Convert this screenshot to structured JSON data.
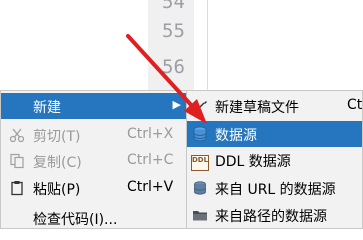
{
  "editor": {
    "line_numbers": [
      "54",
      "55",
      "56"
    ]
  },
  "context_menu": {
    "items": [
      {
        "label": "新建",
        "shortcut": "",
        "has_submenu": true,
        "icon": "",
        "state": "highlighted"
      },
      {
        "label": "剪切(T)",
        "shortcut": "Ctrl+X",
        "has_submenu": false,
        "icon": "scissors-icon",
        "state": "disabled"
      },
      {
        "label": "复制(C)",
        "shortcut": "Ctrl+C",
        "has_submenu": false,
        "icon": "copy-icon",
        "state": "disabled"
      },
      {
        "label": "粘贴(P)",
        "shortcut": "Ctrl+V",
        "has_submenu": false,
        "icon": "paste-icon",
        "state": "enabled"
      },
      {
        "label": "检查代码(I)...",
        "shortcut": "",
        "has_submenu": false,
        "icon": "",
        "state": "enabled"
      }
    ]
  },
  "submenu": {
    "items": [
      {
        "label": "新建草稿文件",
        "shortcut": "Ct",
        "icon": "scratch-file-icon",
        "state": "enabled"
      },
      {
        "label": "数据源",
        "shortcut": "",
        "icon": "database-icon",
        "state": "highlighted"
      },
      {
        "label": "DDL 数据源",
        "shortcut": "",
        "icon": "ddl-icon",
        "icon_text": "DDL",
        "state": "enabled"
      },
      {
        "label": "来自 URL 的数据源",
        "shortcut": "",
        "icon": "url-datasource-icon",
        "state": "enabled"
      },
      {
        "label": "来自路径的数据源",
        "shortcut": "",
        "icon": "folder-icon",
        "state": "enabled"
      }
    ]
  },
  "colors": {
    "highlight": "#2675bf",
    "annotation_arrow": "#e02020",
    "menu_background": "#f2f2f2"
  }
}
